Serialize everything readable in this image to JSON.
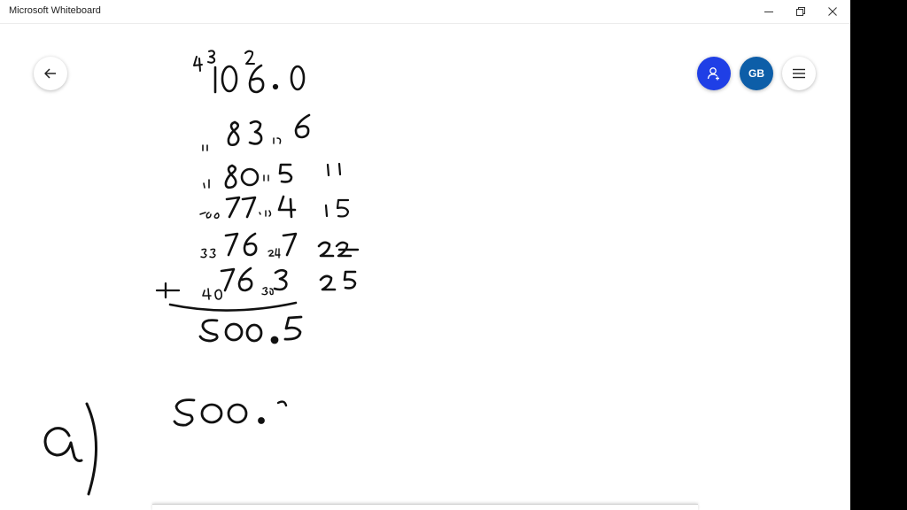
{
  "window": {
    "title": "Microsoft Whiteboard"
  },
  "toolbar": {
    "user_initials": "GB"
  },
  "icons": {
    "back": "arrow-left-icon",
    "invite": "person-add-icon",
    "menu": "hamburger-menu-icon",
    "minimize": "minimize-icon",
    "restore": "restore-icon",
    "close": "close-icon"
  },
  "colors": {
    "ink": "#111111",
    "invite_button": "#1f3fe6",
    "avatar_button": "#0d5ea8"
  }
}
